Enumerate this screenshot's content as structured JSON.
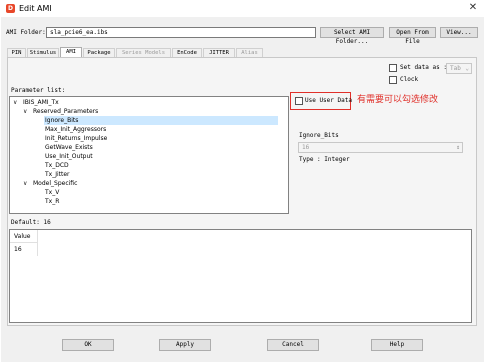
{
  "window": {
    "title": "Edit AMI",
    "app_icon_letter": "D"
  },
  "ami_folder": {
    "label": "AMI Folder:",
    "value": "sla_pcie6_ea.ibs",
    "select_button": "Select AMI Folder...",
    "open_button": "Open From File",
    "view_button": "View..."
  },
  "tabs": [
    {
      "label": "PIN",
      "state": "enabled"
    },
    {
      "label": "Stimulus",
      "state": "enabled"
    },
    {
      "label": "AMI",
      "state": "active"
    },
    {
      "label": "Package",
      "state": "enabled"
    },
    {
      "label": "Series Models",
      "state": "disabled"
    },
    {
      "label": "EnCode",
      "state": "enabled"
    },
    {
      "label": "JITTER",
      "state": "enabled"
    },
    {
      "label": "Alias",
      "state": "disabled"
    }
  ],
  "set_data_as": {
    "label": "Set data as :",
    "value": "Tab"
  },
  "clock": {
    "label": "Clock"
  },
  "parameter_list": {
    "label": "Parameter list:",
    "items": [
      {
        "text": "IBIS_AMI_Tx",
        "level": 0,
        "expanded": true
      },
      {
        "text": "Reserved_Parameters",
        "level": 1,
        "expanded": true
      },
      {
        "text": "Ignore_Bits",
        "level": 2,
        "selected": true
      },
      {
        "text": "Max_Init_Aggressors",
        "level": 2
      },
      {
        "text": "Init_Returns_Impulse",
        "level": 2
      },
      {
        "text": "GetWave_Exists",
        "level": 2
      },
      {
        "text": "Use_Init_Output",
        "level": 2
      },
      {
        "text": "Tx_DCD",
        "level": 2
      },
      {
        "text": "Tx_Jitter",
        "level": 2
      },
      {
        "text": "Model_Specific",
        "level": 1,
        "expanded": true
      },
      {
        "text": "Tx_V",
        "level": 2
      },
      {
        "text": "Tx_R",
        "level": 2
      }
    ]
  },
  "use_user_data": {
    "label": "Use User Data",
    "checked": false
  },
  "annotation": "有需要可以勾选修改",
  "param_detail": {
    "name": "Ignore_Bits",
    "value": "16",
    "type_text": "Type : Integer"
  },
  "default_text": "Default: 16",
  "value_table": {
    "header": "Value",
    "cell": "16"
  },
  "buttons": {
    "ok": "OK",
    "apply": "Apply",
    "cancel": "Cancel",
    "help": "Help"
  },
  "colors": {
    "accent_red": "#e0302a",
    "selection": "#cce8ff"
  }
}
